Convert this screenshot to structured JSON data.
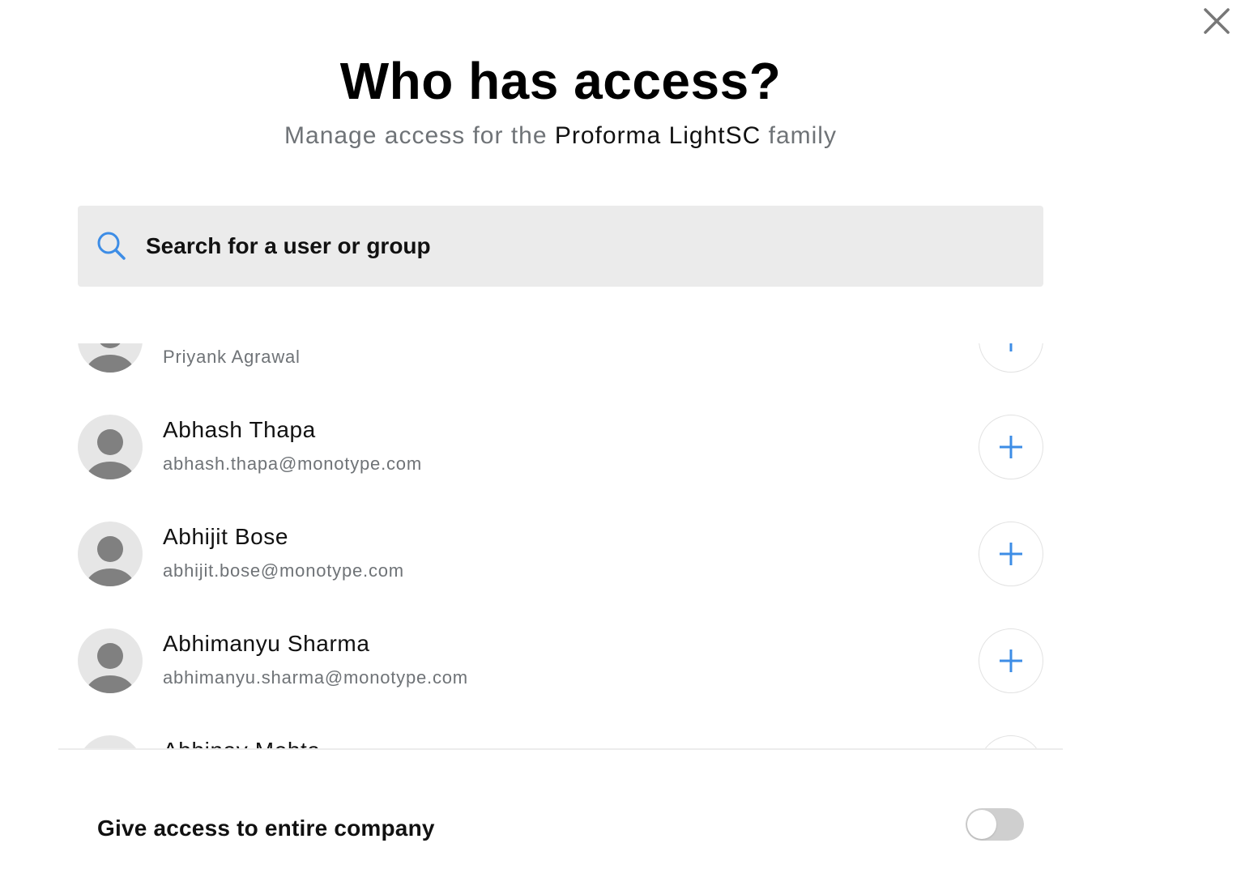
{
  "dialog": {
    "title": "Who has access?",
    "subtitle_prefix": "Manage access for the ",
    "family_name": "Proforma LightSC",
    "subtitle_suffix": " family",
    "close_icon": "close-icon"
  },
  "search": {
    "placeholder": "Search for a user or group",
    "value": "",
    "icon": "search-icon",
    "icon_color": "#3d8de6"
  },
  "users": [
    {
      "name": "",
      "email": "Priyank Agrawal"
    },
    {
      "name": "Abhash Thapa",
      "email": "abhash.thapa@monotype.com"
    },
    {
      "name": "Abhijit Bose",
      "email": "abhijit.bose@monotype.com"
    },
    {
      "name": "Abhimanyu Sharma",
      "email": "abhimanyu.sharma@monotype.com"
    },
    {
      "name": "Abhinav Mehta",
      "email": ""
    }
  ],
  "add_button": {
    "icon": "plus-icon",
    "color": "#3d8de6"
  },
  "company_access": {
    "label": "Give access to entire company",
    "enabled": false
  },
  "colors": {
    "accent": "#3d8de6",
    "muted_text": "#6f7377",
    "search_bg": "#ebebeb",
    "avatar_bg": "#e6e6e6",
    "avatar_fg": "#808080",
    "toggle_off": "#cfcfcf"
  }
}
